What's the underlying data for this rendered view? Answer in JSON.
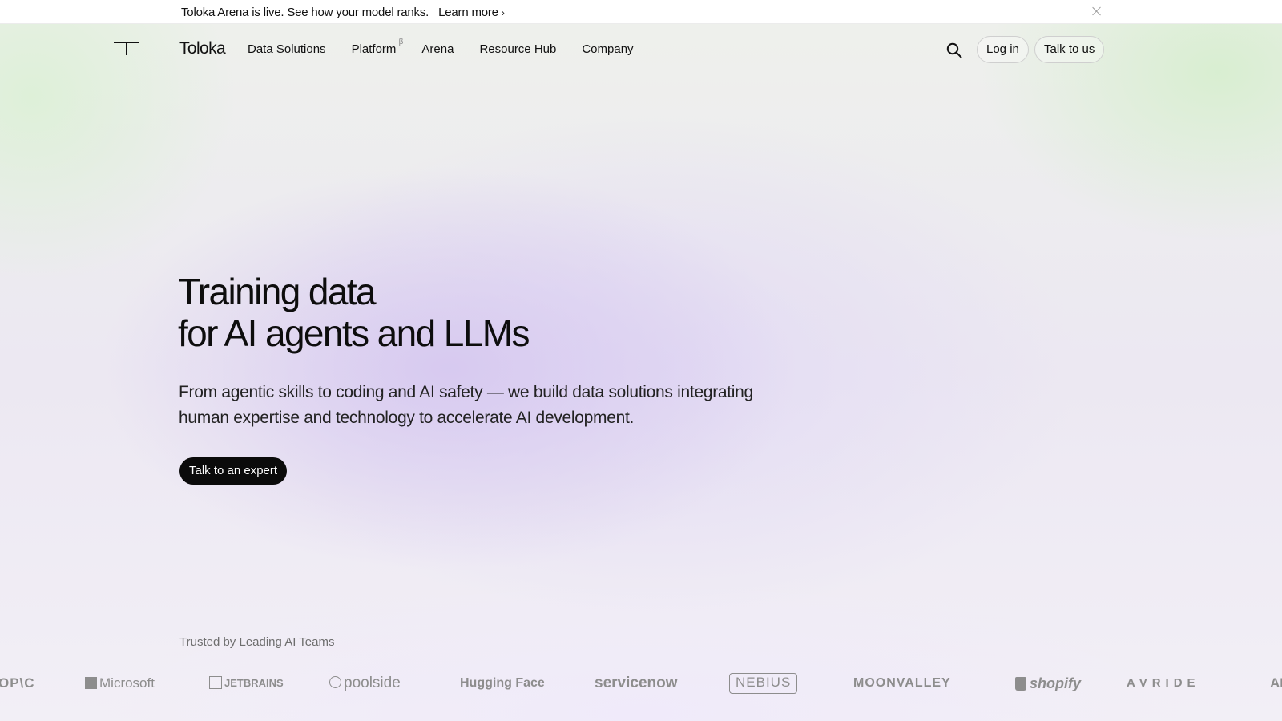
{
  "announcement": {
    "text": "Toloka Arena is live. See how your model ranks.",
    "link": "Learn more",
    "link_chevron": "›"
  },
  "nav": {
    "brand": "Toloka",
    "items": [
      {
        "label": "Data Solutions"
      },
      {
        "label": "Platform",
        "sup": "β"
      },
      {
        "label": "Arena"
      },
      {
        "label": "Resource Hub"
      },
      {
        "label": "Company"
      }
    ],
    "login": "Log in",
    "talk": "Talk to us"
  },
  "hero": {
    "title_line1": "Training data",
    "title_line2": "for AI agents and LLMs",
    "subtitle": "From agentic skills to coding and AI safety — we build data solutions integrating human expertise and technology to accelerate AI development.",
    "cta": "Talk to an expert"
  },
  "trusted": {
    "label": "Trusted by Leading AI Teams",
    "logos": [
      "OP\\C",
      "Microsoft",
      "JETBRAINS",
      "poolside",
      "Hugging Face",
      "servicenow",
      "NEBIUS",
      "MOONVALLEY",
      "shopify",
      "AVRIDE",
      "AI"
    ]
  },
  "colors": {
    "cta_bg": "#0b0b0b",
    "text": "#111111",
    "logo_gray": "#8d8d8d"
  }
}
